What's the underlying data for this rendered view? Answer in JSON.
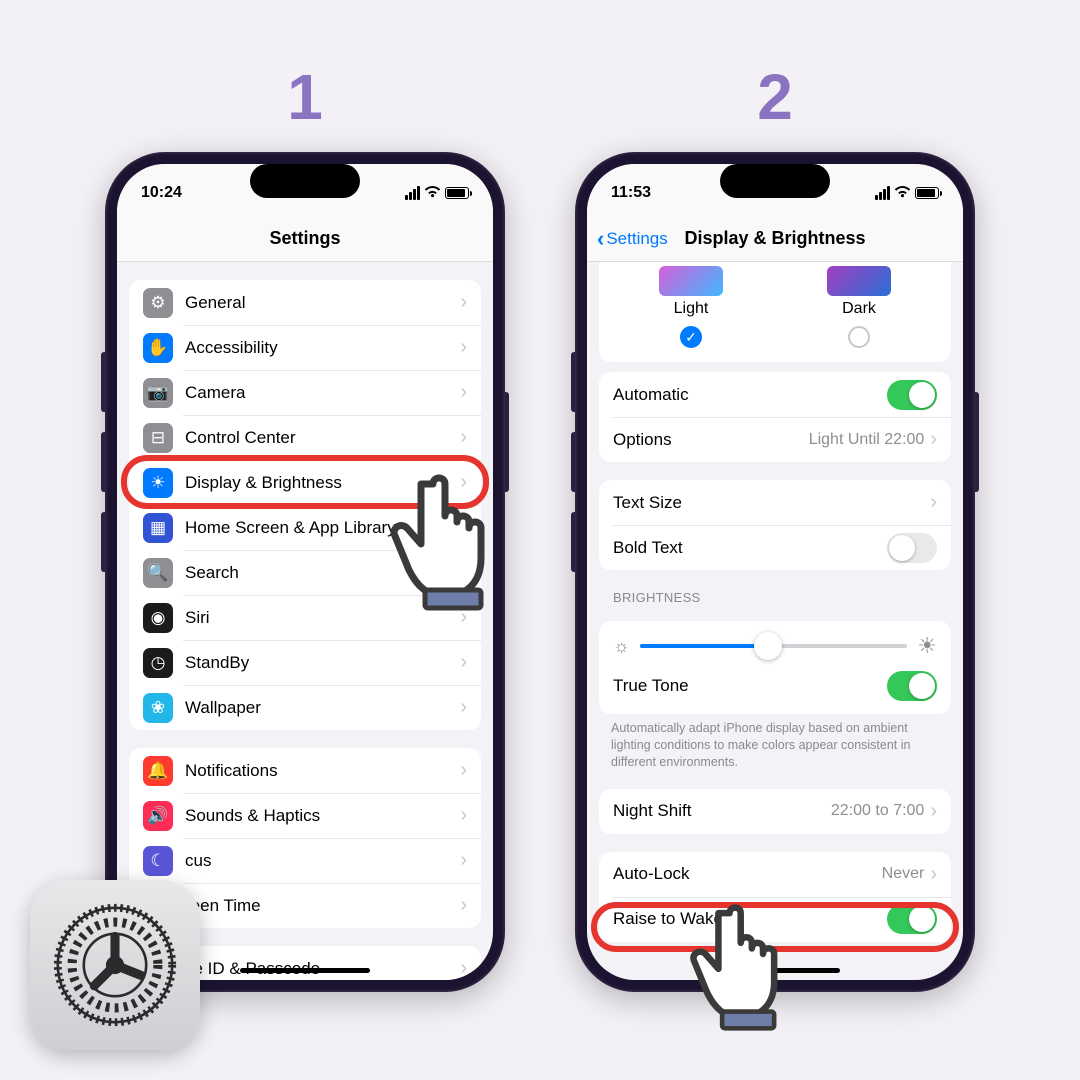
{
  "steps": {
    "one": "1",
    "two": "2"
  },
  "phone1": {
    "time": "10:24",
    "title": "Settings",
    "rows": [
      {
        "label": "General",
        "icon_bg": "#8e8e93",
        "glyph": "⚙"
      },
      {
        "label": "Accessibility",
        "icon_bg": "#007aff",
        "glyph": "✋"
      },
      {
        "label": "Camera",
        "icon_bg": "#8e8e93",
        "glyph": "📷"
      },
      {
        "label": "Control Center",
        "icon_bg": "#8e8e93",
        "glyph": "⊟"
      },
      {
        "label": "Display & Brightness",
        "icon_bg": "#007aff",
        "glyph": "☀"
      },
      {
        "label": "Home Screen & App Library",
        "icon_bg": "#3154d5",
        "glyph": "▦"
      },
      {
        "label": "Search",
        "icon_bg": "#8e8e93",
        "glyph": "🔍"
      },
      {
        "label": "Siri",
        "icon_bg": "#1b1b1d",
        "glyph": "◉"
      },
      {
        "label": "StandBy",
        "icon_bg": "#1b1b1d",
        "glyph": "◷"
      },
      {
        "label": "Wallpaper",
        "icon_bg": "#22b7e8",
        "glyph": "❀"
      }
    ],
    "rows2": [
      {
        "label": "Notifications",
        "icon_bg": "#ff3b30",
        "glyph": "🔔"
      },
      {
        "label": "Sounds & Haptics",
        "icon_bg": "#ff2d55",
        "glyph": "🔊"
      },
      {
        "label_suffix": "cus",
        "icon_bg": "#5856d6",
        "glyph": "☾"
      },
      {
        "label_suffix": "reen Time",
        "icon_bg": "#5856d6",
        "glyph": "⏳"
      }
    ],
    "rows3": [
      {
        "label_suffix": "ce ID & Passcode",
        "icon_bg": "#30d158",
        "glyph": "☻"
      }
    ]
  },
  "phone2": {
    "time": "11:53",
    "back": "Settings",
    "title": "Display & Brightness",
    "appearance": {
      "light": "Light",
      "dark": "Dark"
    },
    "automatic": "Automatic",
    "options": "Options",
    "options_val": "Light Until 22:00",
    "text_size": "Text Size",
    "bold_text": "Bold Text",
    "brightness_header": "BRIGHTNESS",
    "true_tone": "True Tone",
    "true_tone_foot": "Automatically adapt iPhone display based on ambient lighting conditions to make colors appear consistent in different environments.",
    "night_shift": "Night Shift",
    "night_shift_val": "22:00 to 7:00",
    "auto_lock": "Auto-Lock",
    "auto_lock_val": "Never",
    "raise_to_wake": "Raise to Wake"
  }
}
